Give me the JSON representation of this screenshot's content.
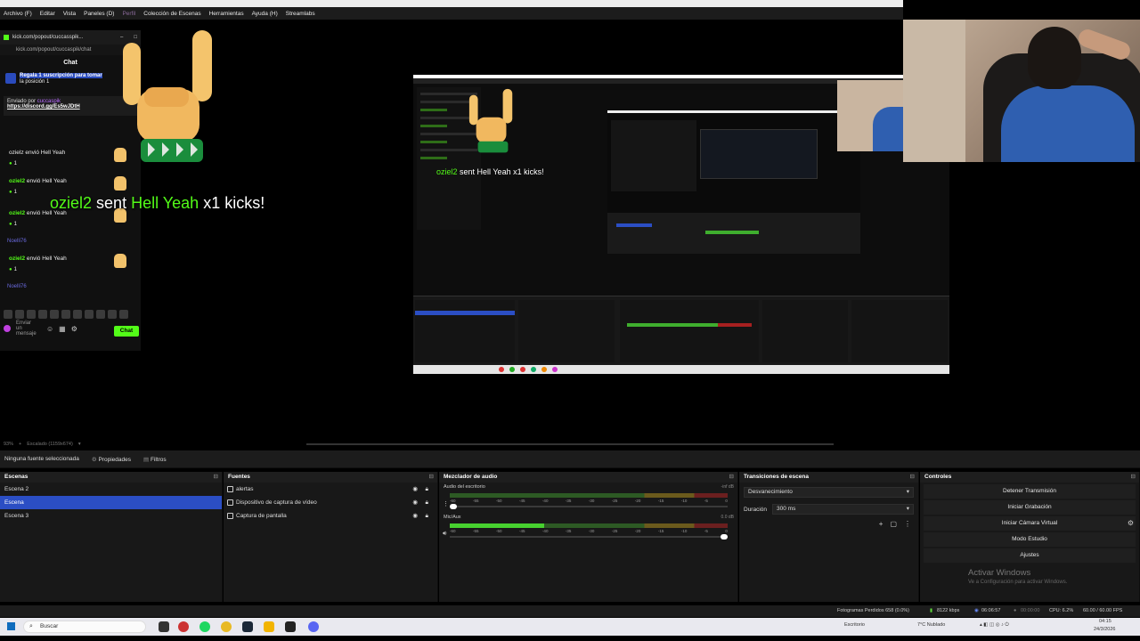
{
  "menubar": {
    "items": [
      "Archivo (F)",
      "Editar",
      "Vista",
      "Paneles (D)",
      "Perfil",
      "Colección de Escenas",
      "Herramientas",
      "Ayuda (H)",
      "Streamlabs"
    ]
  },
  "chat": {
    "tab_url": "kick.com/popout/cuccasspik...",
    "url": "kick.com/popout/cuccaspik/chat",
    "title": "Chat",
    "promo_line1": "Regala 1 suscripción para tomar",
    "promo_line2": "la posición 1",
    "pinned_prefix": "Enviado por",
    "pinned_user": "cuccaspik",
    "pinned_link": "https://discord.gg/Es5wJDtH",
    "partial_msg": "ozielz envió Hell Yeah",
    "messages": [
      {
        "user": "oziel2",
        "text": "envió Hell Yeah",
        "count": "1"
      },
      {
        "user": "oziel2",
        "text": "envió Hell Yeah",
        "count": "1"
      },
      {
        "user": "oziel2",
        "text": "envió Hell Yeah",
        "count": "1"
      }
    ],
    "sys1": "Noelli76",
    "sys2": "Noelli76",
    "placeholder_l1": "Enviar",
    "placeholder_l2": "un",
    "placeholder_l3": "mensaje",
    "send_label": "Chat"
  },
  "alert": {
    "user": "oziel2",
    "sent": "sent",
    "item": "Hell Yeah",
    "tail": "x1 kicks!"
  },
  "nested_alert": {
    "user": "oziel2",
    "rest": "sent Hell Yeah x1 kicks!"
  },
  "canvas_status": {
    "zoom": "93%",
    "mode": "Escalado (1159x674)"
  },
  "propbar": {
    "no_source": "Ninguna fuente seleccionada",
    "properties": "Propiedades",
    "filters": "Filtros"
  },
  "scenes": {
    "title": "Escenas",
    "items": [
      "Escena 2",
      "Escena",
      "Escena 3"
    ],
    "selected": 1
  },
  "sources": {
    "title": "Fuentes",
    "items": [
      "alertas",
      "Dispositivo de captura de vídeo",
      "Captura de pantalla"
    ]
  },
  "mixer": {
    "title": "Mezclador de audio",
    "channels": [
      {
        "name": "Audio del escritorio",
        "db": "-inf dB",
        "level": 0.0,
        "volume": 0.02
      },
      {
        "name": "Mic/Aux",
        "db": "0.0 dB",
        "level": 0.34,
        "volume": 1.0
      }
    ],
    "scale": [
      "-60",
      "-55",
      "-50",
      "-45",
      "-40",
      "-35",
      "-30",
      "-25",
      "-20",
      "-15",
      "-10",
      "-5",
      "0"
    ]
  },
  "transitions": {
    "title": "Transiciones de escena",
    "type": "Desvanecimiento",
    "duration_label": "Duración",
    "duration": "300 ms"
  },
  "controls": {
    "title": "Controles",
    "buttons": [
      "Detener Transmisión",
      "Iniciar Grabación",
      "Iniciar Cámara Virtual",
      "Modo Estudio",
      "Ajustes"
    ],
    "watermark_title": "Activar Windows",
    "watermark_sub": "Ve a Configuración para activar Windows."
  },
  "statusbar": {
    "dropped": "Fotogramas Perdidos 658 (0.0%)",
    "bitrate": "8122 kbps",
    "live_time": "06:06:57",
    "rec_time": "00:00:00",
    "cpu": "CPU: 6.2%",
    "fps": "60.00 / 60.00 FPS"
  },
  "taskbar": {
    "search": "Buscar",
    "tray_desktop": "Escritorio",
    "weather": "7°C Nublado",
    "time": "04:15",
    "date": "24/3/2026"
  }
}
